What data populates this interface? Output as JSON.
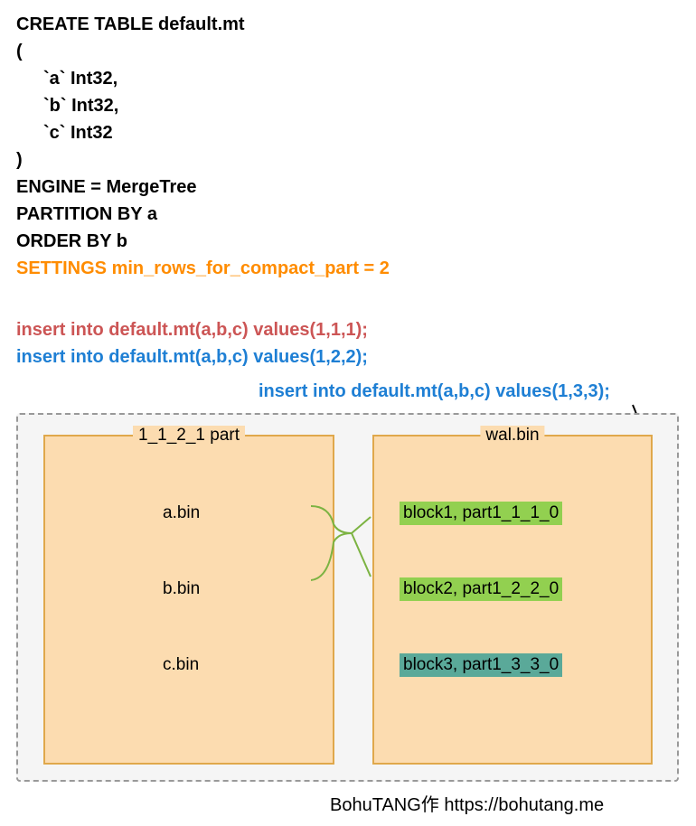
{
  "code": {
    "line1": "CREATE TABLE default.mt",
    "line2": "(",
    "line3": "`a` Int32,",
    "line4": "`b` Int32,",
    "line5": "`c` Int32",
    "line6": ")",
    "line7": "ENGINE = MergeTree",
    "line8": "PARTITION BY a",
    "line9": "ORDER BY b",
    "line10": "SETTINGS min_rows_for_compact_part = 2"
  },
  "inserts": {
    "red": "insert into default.mt(a,b,c) values(1,1,1);",
    "blue1": "insert into default.mt(a,b,c) values(1,2,2);",
    "blue2": "insert into default.mt(a,b,c) values(1,3,3);"
  },
  "part": {
    "title": "1_1_2_1 part",
    "files": {
      "a": "a.bin",
      "b": "b.bin",
      "c": "c.bin"
    }
  },
  "wal": {
    "title": "wal.bin",
    "blocks": {
      "b1": "block1, part1_1_1_0",
      "b2": "block2, part1_2_2_0",
      "b3": "block3, part1_3_3_0"
    }
  },
  "credit": "BohuTANG作 https://bohutang.me"
}
